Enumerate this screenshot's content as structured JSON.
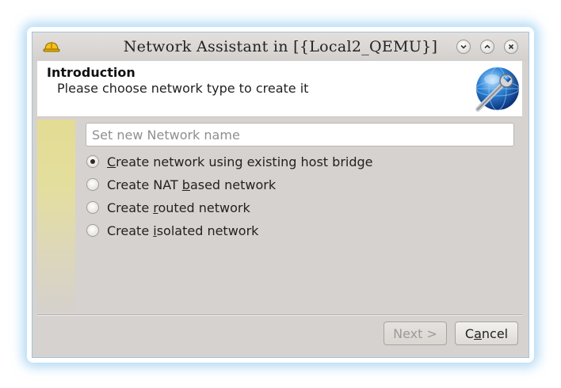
{
  "window": {
    "title": "Network Assistant in [{Local2_QEMU}]",
    "accent": "#9fc3de",
    "buttons": [
      "minimize-icon",
      "maximize-icon",
      "close-icon"
    ]
  },
  "header": {
    "title": "Introduction",
    "subtitle": "Please choose network type to create it"
  },
  "form": {
    "name_placeholder": "Set new Network name",
    "name_value": "",
    "options": [
      {
        "pre": "",
        "mn": "C",
        "post": "reate network using existing host bridge",
        "checked": true
      },
      {
        "pre": "Create NAT ",
        "mn": "b",
        "post": "ased network",
        "checked": false
      },
      {
        "pre": "Create ",
        "mn": "r",
        "post": "outed network",
        "checked": false
      },
      {
        "pre": "Create ",
        "mn": "i",
        "post": "solated network",
        "checked": false
      }
    ]
  },
  "footer": {
    "next_label": "Next >",
    "next_enabled": false,
    "cancel_pre": "C",
    "cancel_mn": "a",
    "cancel_post": "ncel"
  }
}
